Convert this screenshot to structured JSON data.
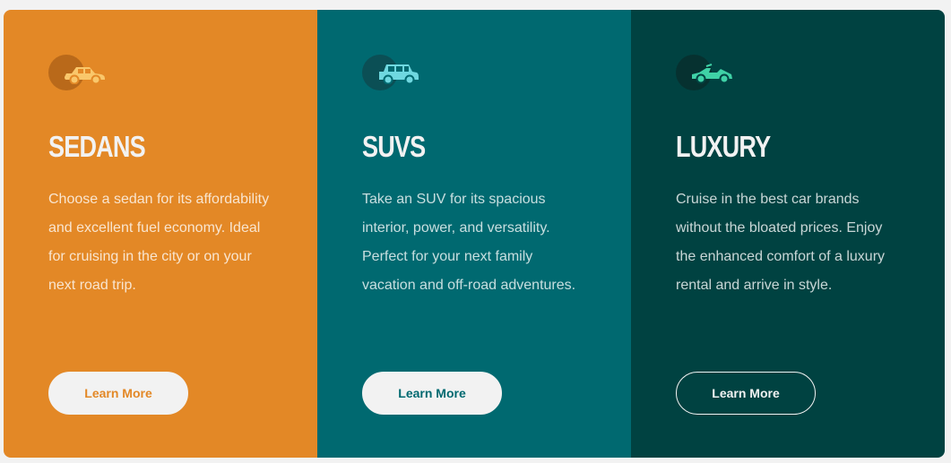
{
  "colors": {
    "sedans_bg": "#e38826",
    "suvs_bg": "#006970",
    "luxury_bg": "#004241",
    "text_light": "#f2f2f2"
  },
  "cards": [
    {
      "icon": "sedan-car-icon",
      "title": "Sedans",
      "text": "Choose a sedan for its affordability and excellent fuel economy. Ideal for cruising in the city or on your next road trip.",
      "button_label": "Learn More"
    },
    {
      "icon": "suv-car-icon",
      "title": "SUVs",
      "text": "Take an SUV for its spacious interior, power, and versatility. Perfect for your next family vacation and off-road adventures.",
      "button_label": "Learn More"
    },
    {
      "icon": "luxury-car-icon",
      "title": "Luxury",
      "text": "Cruise in the best car brands without the bloated prices. Enjoy the enhanced comfort of a luxury rental and arrive in style.",
      "button_label": "Learn More"
    }
  ]
}
